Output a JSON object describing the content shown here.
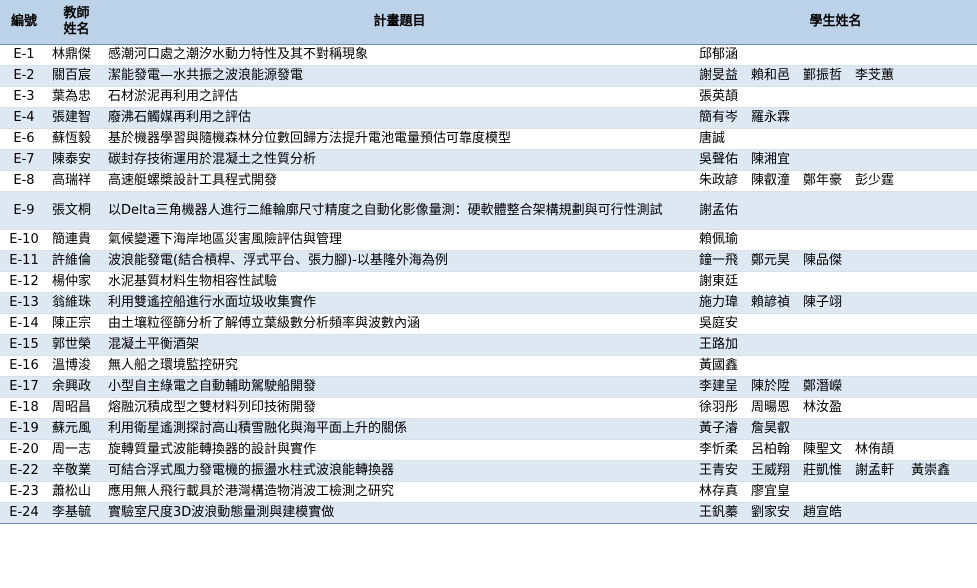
{
  "header": {
    "id": "編號",
    "teacher": "教師\n姓名",
    "project": "計畫題目",
    "students": "學生姓名"
  },
  "rows": [
    {
      "id": "E-1",
      "teacher": "林鼎傑",
      "project": "感潮河口處之潮汐水動力特性及其不對稱現象",
      "students": "邱郁涵"
    },
    {
      "id": "E-2",
      "teacher": "關百宸",
      "project": "潔能發電—水共振之波浪能源發電",
      "students": "謝旻益　賴和邑　鄞振哲　李芠蕙"
    },
    {
      "id": "E-3",
      "teacher": "葉為忠",
      "project": "石材淤泥再利用之評估",
      "students": "張英頡"
    },
    {
      "id": "E-4",
      "teacher": "張建智",
      "project": "廢沸石觸媒再利用之評估",
      "students": "簡有岑　羅永霖"
    },
    {
      "id": "E-6",
      "teacher": "蘇恆毅",
      "project": "基於機器學習與隨機森林分位數回歸方法提升電池電量預估可靠度模型",
      "students": " 唐誠"
    },
    {
      "id": "E-7",
      "teacher": "陳泰安",
      "project": "碳封存技術運用於混凝土之性質分析",
      "students": "吳聲佑　陳湘宜"
    },
    {
      "id": "E-8",
      "teacher": "高瑞祥",
      "project": "高速艇螺槳設計工具程式開發",
      "students": "朱政諺　陳叡潼　鄭年豪　彭少霆"
    },
    {
      "id": "E-9",
      "teacher": "張文桐",
      "project": "以Delta三角機器人進行二維輪廓尺寸精度之自動化影像量測：硬軟體整合架構規劃與可行性測試",
      "students": "謝孟佑"
    },
    {
      "id": "E-10",
      "teacher": "簡連貴",
      "project": "氣候變遷下海岸地區災害風險評估與管理",
      "students": "賴佩瑜"
    },
    {
      "id": "E-11",
      "teacher": "許維倫",
      "project": "波浪能發電(結合槓桿、浮式平台、張力腳)-以基隆外海為例",
      "students": "鐘一飛　鄭元昊　陳品傑"
    },
    {
      "id": "E-12",
      "teacher": "楊仲家",
      "project": "水泥基質材料生物相容性試驗",
      "students": "謝東廷"
    },
    {
      "id": "E-13",
      "teacher": "翁維珠",
      "project": "利用雙遙控船進行水面垃圾收集實作",
      "students": "施力瑋　賴諺禎　陳子翊"
    },
    {
      "id": "E-14",
      "teacher": "陳正宗",
      "project": "由土壤粒徑篩分析了解傅立葉級數分析頻率與波數內涵",
      "students": "吳庭安"
    },
    {
      "id": "E-15",
      "teacher": "郭世榮",
      "project": "混凝土平衡酒架",
      "students": "王路加"
    },
    {
      "id": "E-16",
      "teacher": "溫博浚",
      "project": "無人船之環境監控研究",
      "students": "黃國鑫"
    },
    {
      "id": "E-17",
      "teacher": "余興政",
      "project": "小型自主綠電之自動輔助駕駛船開發",
      "students": "李建呈　陳於陞　鄭潛嶸"
    },
    {
      "id": "E-18",
      "teacher": "周昭昌",
      "project": "熔融沉積成型之雙材料列印技術開發",
      "students": "徐羽彤　周暘恩　林汝盈"
    },
    {
      "id": "E-19",
      "teacher": "蘇元風",
      "project": "利用衛星遙測探討高山積雪融化與海平面上升的關係",
      "students": "黃子濬　詹昊叡"
    },
    {
      "id": "E-20",
      "teacher": "周一志",
      "project": "旋轉質量式波能轉換器的設計與實作",
      "students": "李忻柔　呂柏翰　陳聖文　林侑頡"
    },
    {
      "id": "E-22",
      "teacher": "辛敬業",
      "project": "可結合浮式風力發電機的振盪水柱式波浪能轉換器",
      "students": "王青安　王威翔　莊凱惟　謝孟軒　 黃崇鑫"
    },
    {
      "id": "E-23",
      "teacher": "蕭松山",
      "project": "應用無人飛行載具於港灣構造物消波工檢測之研究",
      "students": "林存真　廖宜皇"
    },
    {
      "id": "E-24",
      "teacher": "李基毓",
      "project": "實驗室尺度3D波浪動態量測與建模實做",
      "students": "王釩蓁　劉家安　趙宣皓"
    }
  ]
}
